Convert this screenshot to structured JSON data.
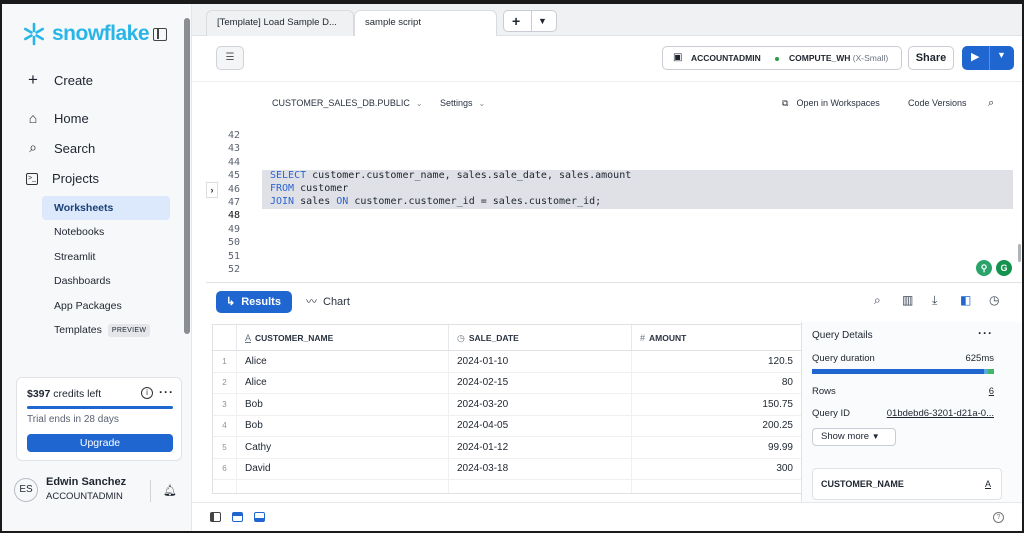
{
  "brand": {
    "name": "snowflake",
    "color": "#29b5e8"
  },
  "sidebar": {
    "create_label": "Create",
    "items": [
      {
        "label": "Home",
        "icon": "home-icon"
      },
      {
        "label": "Search",
        "icon": "search-icon"
      },
      {
        "label": "Projects",
        "icon": "terminal-icon"
      }
    ],
    "sub_items": [
      {
        "label": "Worksheets",
        "active": true
      },
      {
        "label": "Notebooks"
      },
      {
        "label": "Streamlit"
      },
      {
        "label": "Dashboards"
      },
      {
        "label": "App Packages"
      },
      {
        "label": "Templates",
        "badge": "PREVIEW"
      }
    ],
    "credits": {
      "amount": "$397",
      "suffix": "credits left",
      "trial": "Trial ends in 28 days",
      "upgrade_label": "Upgrade"
    },
    "user": {
      "initials": "ES",
      "name": "Edwin Sanchez",
      "role": "ACCOUNTADMIN"
    }
  },
  "tabs": [
    {
      "label": "[Template] Load Sample D...",
      "active": false
    },
    {
      "label": "sample script",
      "active": true
    }
  ],
  "toolbar": {
    "role": "ACCOUNTADMIN",
    "warehouse": "COMPUTE_WH",
    "warehouse_size": "(X-Small)",
    "share_label": "Share",
    "status_color": "#2e9a47"
  },
  "context": {
    "database": "CUSTOMER_SALES_DB.PUBLIC",
    "settings_label": "Settings",
    "open_workspaces": "Open in Workspaces",
    "code_versions": "Code Versions"
  },
  "editor": {
    "line_numbers": [
      "42",
      "43",
      "44",
      "45",
      "46",
      "47",
      "48",
      "49",
      "50",
      "51",
      "52"
    ],
    "current_line": "48",
    "code": [
      {
        "kw": "SELECT",
        "rest": " customer.customer_name, sales.sale_date, sales.amount"
      },
      {
        "kw": "FROM",
        "rest": " customer"
      },
      {
        "kw": "JOIN",
        "rest": " sales ",
        "kw2": "ON",
        "rest2": " customer.customer_id = sales.customer_id;"
      }
    ]
  },
  "results": {
    "results_label": "Results",
    "chart_label": "Chart",
    "columns": [
      {
        "name": "CUSTOMER_NAME",
        "type_icon": "A"
      },
      {
        "name": "SALE_DATE",
        "type_icon": "clock"
      },
      {
        "name": "AMOUNT",
        "type_icon": "#"
      }
    ],
    "rows": [
      {
        "n": "1",
        "name": "Alice",
        "date": "2024-01-10",
        "amount": "120.5"
      },
      {
        "n": "2",
        "name": "Alice",
        "date": "2024-02-15",
        "amount": "80"
      },
      {
        "n": "3",
        "name": "Bob",
        "date": "2024-03-20",
        "amount": "150.75"
      },
      {
        "n": "4",
        "name": "Bob",
        "date": "2024-04-05",
        "amount": "200.25"
      },
      {
        "n": "5",
        "name": "Cathy",
        "date": "2024-01-12",
        "amount": "99.99"
      },
      {
        "n": "6",
        "name": "David",
        "date": "2024-03-18",
        "amount": "300"
      }
    ]
  },
  "query_details": {
    "title": "Query Details",
    "duration_label": "Query duration",
    "duration": "625ms",
    "rows_label": "Rows",
    "rows": "6",
    "query_id_label": "Query ID",
    "query_id": "01bdebd6-3201-d21a-0...",
    "show_more": "Show more",
    "column_card": "CUSTOMER_NAME",
    "column_card_type": "A"
  }
}
